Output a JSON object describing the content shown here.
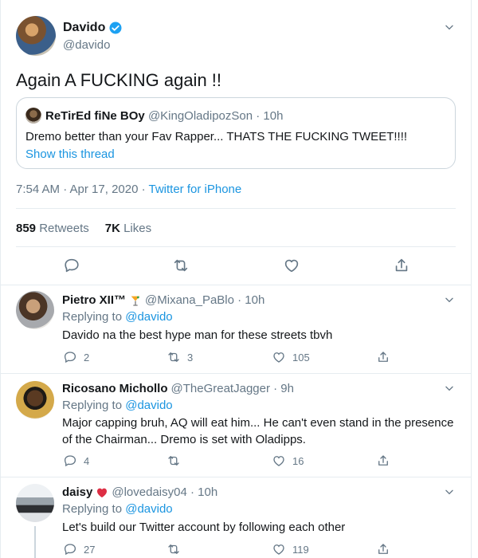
{
  "main_tweet": {
    "author_name": "Davido",
    "author_handle": "@davido",
    "text": "Again A FUCKING again !!",
    "timestamp": "7:54 AM · Apr 17, 2020 · ",
    "source": "Twitter for iPhone",
    "retweets_count": "859",
    "retweets_label": "Retweets",
    "likes_count": "7K",
    "likes_label": "Likes",
    "quoted": {
      "author_name": "ReTirEd fiNe BOy",
      "meta": "@KingOladipozSon · 10h",
      "text": "Dremo better than your Fav Rapper... THATS THE FUCKING TWEET!!!!",
      "link": "Show this thread"
    }
  },
  "replies": [
    {
      "name": "Pietro XII™",
      "emoji": "cocktail",
      "meta": "@Mixana_PaBlo · 10h",
      "replying_prefix": "Replying to",
      "replying_to": "@davido",
      "text": "Davido na the best hype man for these streets tbvh",
      "reply_count": "2",
      "retweet_count": "3",
      "like_count": "105"
    },
    {
      "name": "Ricosano Michollo",
      "emoji": "",
      "meta": "@TheGreatJagger · 9h",
      "replying_prefix": "Replying to",
      "replying_to": "@davido",
      "text": "Major capping bruh, AQ will eat him... He can't even stand in the presence of the Chairman... Dremo is set with Oladipps.",
      "reply_count": "4",
      "retweet_count": "",
      "like_count": "16"
    },
    {
      "name": "daisy",
      "emoji": "heart",
      "meta": "@lovedaisy04 · 10h",
      "replying_prefix": "Replying to",
      "replying_to": "@davido",
      "text": "Let's build our Twitter account by following each other",
      "reply_count": "27",
      "retweet_count": "",
      "like_count": "119"
    }
  ],
  "colors": {
    "accent": "#1b95e0",
    "muted": "#657786",
    "border": "#e6ecf0",
    "verified": "#1da1f2"
  },
  "icons": [
    "chevron-down-icon",
    "verified-badge-icon",
    "reply-icon",
    "retweet-icon",
    "like-icon",
    "share-icon"
  ]
}
